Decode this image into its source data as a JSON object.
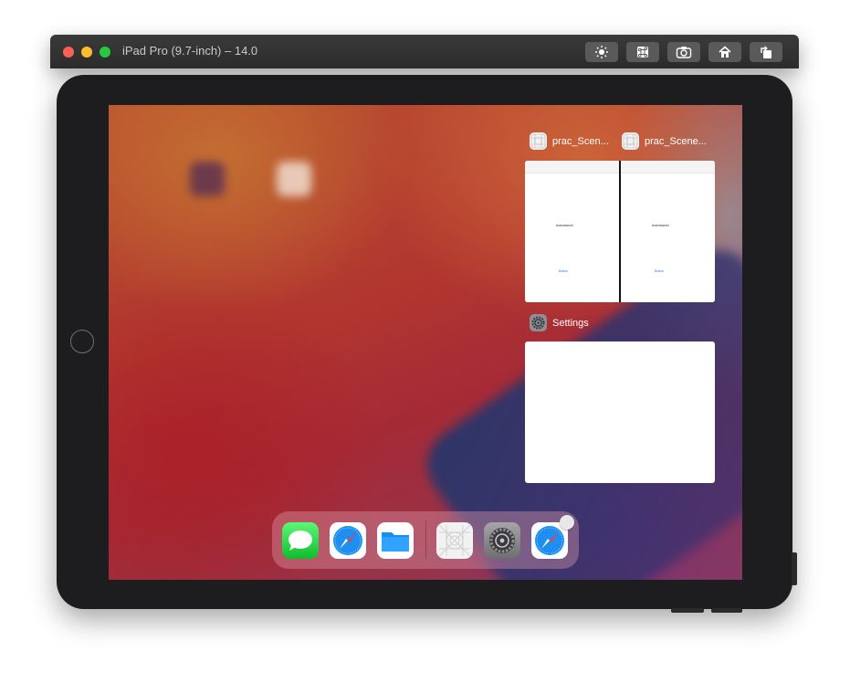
{
  "window": {
    "title": "iPad Pro (9.7-inch) – 14.0",
    "toolbar": [
      {
        "name": "brightness-icon"
      },
      {
        "name": "command-icon"
      },
      {
        "name": "screenshot-camera-icon"
      },
      {
        "name": "home-icon"
      },
      {
        "name": "rotate-icon"
      }
    ]
  },
  "switcher": {
    "top_left": {
      "label": "prac_Scen...",
      "icon": "grid-app-icon",
      "text": "nolomorch",
      "button": "Button"
    },
    "top_right": {
      "label": "prac_Scene...",
      "icon": "grid-app-icon",
      "text": "nolomorch",
      "button": "Button"
    },
    "settings": {
      "label": "Settings",
      "icon": "settings-gear-icon"
    }
  },
  "dock": {
    "apps": [
      {
        "name": "messages-icon"
      },
      {
        "name": "safari-icon"
      },
      {
        "name": "files-icon"
      },
      {
        "name": "grid-app-icon"
      },
      {
        "name": "settings-gear-icon"
      },
      {
        "name": "safari-icon"
      }
    ]
  },
  "colors": {
    "titlebar": "#2e2e2e",
    "device": "#1d1d1f",
    "accent_blue": "#2b7cf6"
  }
}
